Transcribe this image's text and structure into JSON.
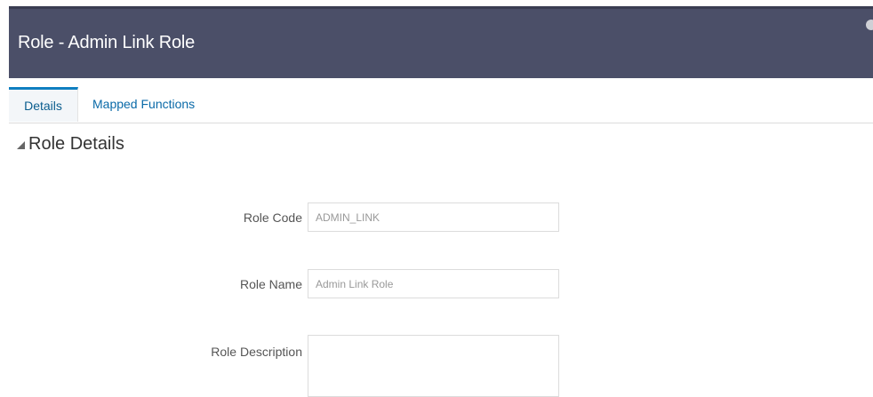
{
  "header": {
    "title": "Role - Admin Link Role"
  },
  "tabs": [
    {
      "label": "Details",
      "active": true
    },
    {
      "label": "Mapped Functions",
      "active": false
    }
  ],
  "section": {
    "title": "Role Details"
  },
  "form": {
    "role_code": {
      "label": "Role Code",
      "value": "ADMIN_LINK"
    },
    "role_name": {
      "label": "Role Name",
      "value": "Admin Link Role"
    },
    "role_description": {
      "label": "Role Description",
      "value": ""
    }
  },
  "colors": {
    "header_bg": "#4b4f68",
    "tab_active": "#0f7fc0",
    "link": "#0a6aa8"
  }
}
